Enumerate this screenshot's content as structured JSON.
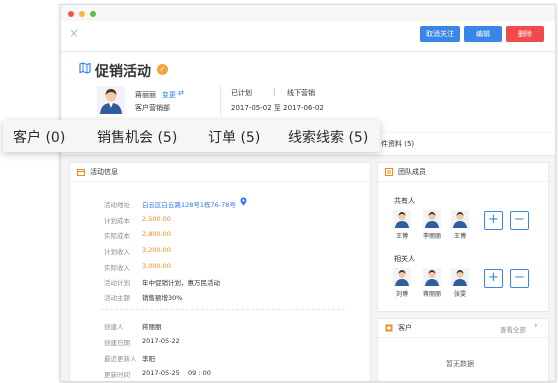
{
  "toolbar": {
    "close_glyph": "×",
    "buttons": [
      {
        "label": "取消关注",
        "color": "#3a86e6"
      },
      {
        "label": "编辑",
        "color": "#3a86e6"
      },
      {
        "label": "删除",
        "color": "#f04a4a"
      }
    ]
  },
  "header": {
    "title": "促销活动",
    "owner_name": "蒋丽丽",
    "change_link": "变更",
    "department": "客户营销部",
    "status": "已计划",
    "separator": "|",
    "channel": "线下营销",
    "date_range": "2017-05-02 至 2017-06-02"
  },
  "tabs": {
    "items": [
      {
        "label": "客户 (0)"
      },
      {
        "label": "销售机会 (5)"
      },
      {
        "label": "订单 (5)"
      },
      {
        "label": "线索线索 (5)"
      }
    ],
    "hidden_tab_fragment": "件资料 (5)"
  },
  "activity": {
    "title": "活动信息",
    "fields": [
      {
        "label": "活动地址",
        "value": "白云区白云路128号1栋76-78号"
      },
      {
        "label": "计划成本",
        "value": "2,500.00"
      },
      {
        "label": "实际成本",
        "value": "2,800.00"
      },
      {
        "label": "计划收入",
        "value": "3,200.00"
      },
      {
        "label": "实际收入",
        "value": "3,000.00"
      },
      {
        "label": "活动计划",
        "value": "年中促销计划，惠万民活动"
      },
      {
        "label": "活动主题",
        "value": "销售额增30%"
      }
    ],
    "meta": [
      {
        "label": "创建人",
        "value": "蒋丽丽"
      },
      {
        "label": "创建日期",
        "value": "2017-05-22"
      },
      {
        "label": "最近更新人",
        "value": "李阳"
      },
      {
        "label": "更新时间",
        "value": "2017-05-25    09 : 00"
      }
    ]
  },
  "team": {
    "title": "团队成员",
    "owners_label": "共有人",
    "owners": [
      "王博",
      "李丽丽",
      "王博"
    ],
    "related_label": "相关人",
    "related": [
      "刘博",
      "蒋丽丽",
      "张雯"
    ],
    "add_glyph": "+",
    "remove_glyph": "−"
  },
  "customer": {
    "title": "客户",
    "view_all": "查看全部",
    "chevron": "›",
    "empty_text": "暂无数据"
  }
}
